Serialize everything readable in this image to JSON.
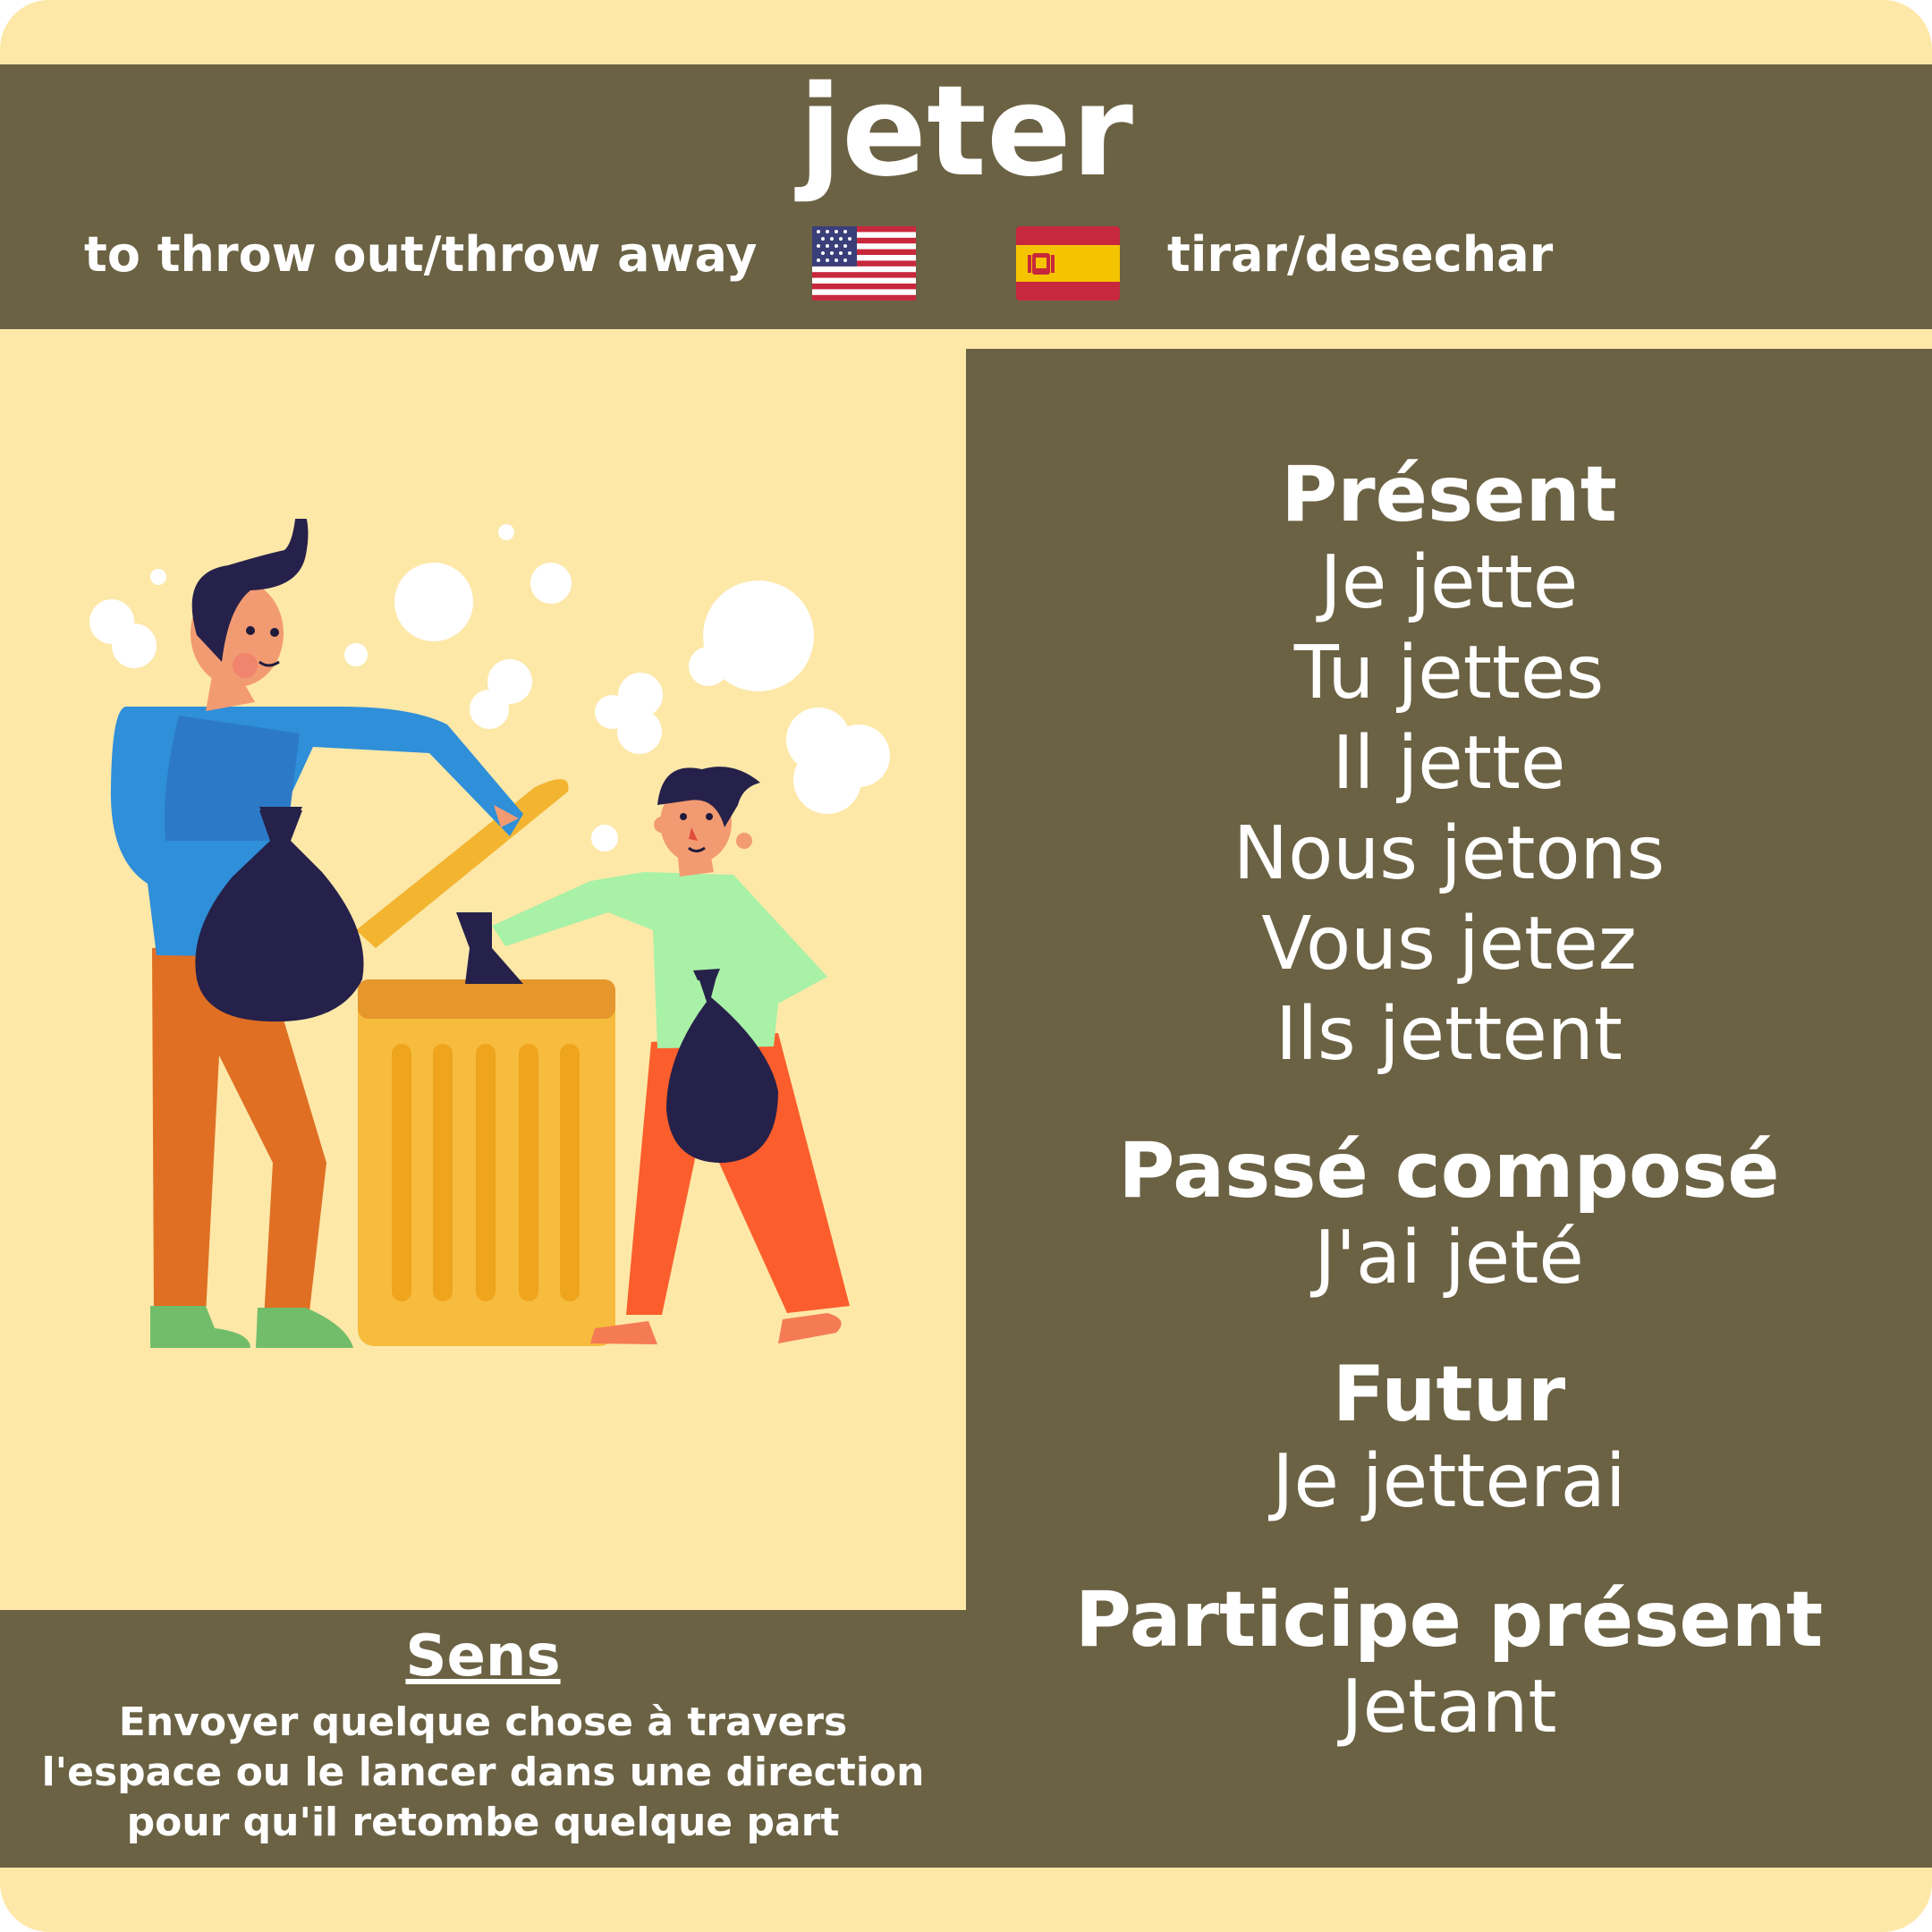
{
  "header": {
    "title": "jeter",
    "english": "to throw out/throw away",
    "spanish": "tirar/desechar",
    "flag_left_icon": "us-flag-icon",
    "flag_right_icon": "spain-flag-icon"
  },
  "colors": {
    "background": "#fde8a8",
    "panel": "#6b6244",
    "text": "#ffffff"
  },
  "conjugation": {
    "present": {
      "heading": "Présent",
      "forms": [
        "Je jette",
        "Tu jettes",
        "Il jette",
        "Nous jetons",
        "Vous jetez",
        "Ils jettent"
      ]
    },
    "passe_compose": {
      "heading": "Passé composé",
      "form": "J'ai jeté"
    },
    "futur": {
      "heading": "Futur",
      "form": "Je jetterai"
    },
    "participe_present": {
      "heading": "Participe présent",
      "form": "Jetant"
    }
  },
  "sens": {
    "title": "Sens",
    "lines": [
      "Envoyer quelque chose à travers",
      "l'espace ou le lancer dans une direction",
      "pour qu'il retombe quelque part"
    ]
  },
  "illustration": {
    "icon": "people-throwing-trash-illustration"
  }
}
